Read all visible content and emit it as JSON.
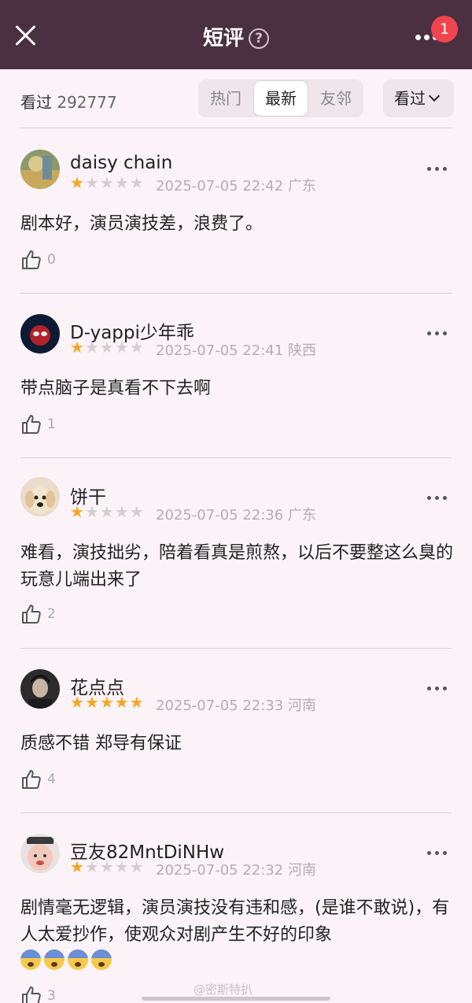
{
  "header": {
    "title": "短评",
    "help_glyph": "?",
    "badge_count": "1"
  },
  "subheader": {
    "seen_label": "看过",
    "seen_count": "292777",
    "tabs": [
      {
        "label": "热门",
        "active": false
      },
      {
        "label": "最新",
        "active": true
      },
      {
        "label": "友邻",
        "active": false
      }
    ],
    "filter_label": "看过"
  },
  "reviews": [
    {
      "user": "daisy chain",
      "rating": 1,
      "time": "2025-07-05 22:42",
      "location": "广东",
      "text": "剧本好，演员演技差，浪费了。",
      "likes": "0"
    },
    {
      "user": "D-yappi少年乖",
      "rating": 1,
      "time": "2025-07-05 22:41",
      "location": "陕西",
      "text": "带点脑子是真看不下去啊",
      "likes": "1"
    },
    {
      "user": "饼干",
      "rating": 1,
      "time": "2025-07-05 22:36",
      "location": "广东",
      "text": "难看，演技拙劣，陪着看真是煎熬，以后不要整这么臭的玩意儿端出来了",
      "likes": "2"
    },
    {
      "user": "花点点",
      "rating": 5,
      "time": "2025-07-05 22:33",
      "location": "河南",
      "text": "质感不错 郑导有保证",
      "likes": "4"
    },
    {
      "user": "豆友82MntDiNHw",
      "rating": 1,
      "time": "2025-07-05 22:32",
      "location": "河南",
      "text": "剧情毫无逻辑，演员演技没有违和感，(是谁不敢说)，有人太爱抄作，使观众对剧产生不好的印象",
      "likes": "3"
    }
  ],
  "watermark": "@密斯特扒",
  "colors": {
    "header_bg": "#4a3041",
    "page_bg": "#fbf3f7",
    "star_on": "#f6a623",
    "badge": "#f0454f"
  }
}
